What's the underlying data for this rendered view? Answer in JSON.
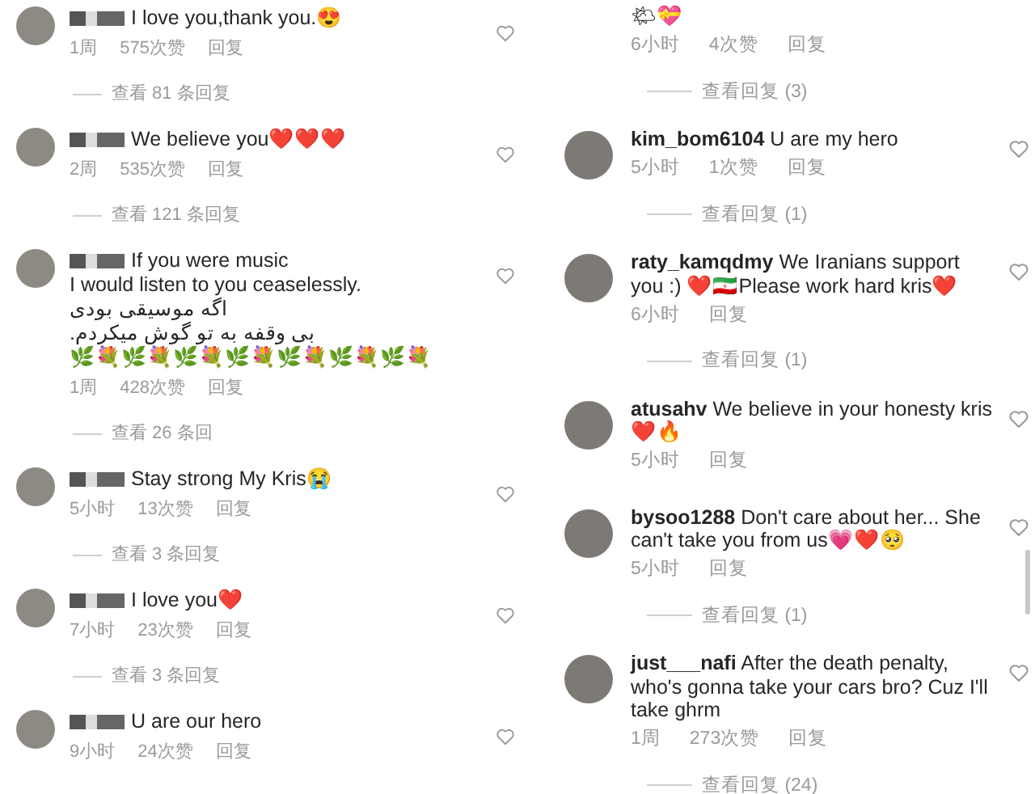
{
  "left_column": {
    "comments": [
      {
        "lines": [
          "I love you,thank you.😍"
        ],
        "time": "1周",
        "likes": "575次赞",
        "reply": "回复",
        "view_replies": "查看 81 条回复"
      },
      {
        "lines": [
          "We believe you❤️❤️❤️"
        ],
        "time": "2周",
        "likes": "535次赞",
        "reply": "回复",
        "view_replies": "查看 121 条回复"
      },
      {
        "lines": [
          "If you were music",
          "I would listen to you ceaselessly.",
          "اگه موسیقی بودی",
          "بی وقفه به تو گوش میکردم.",
          "🌿💐🌿💐🌿💐🌿💐🌿💐🌿💐🌿💐"
        ],
        "time": "1周",
        "likes": "428次赞",
        "reply": "回复",
        "view_replies": "查看 26 条回"
      },
      {
        "lines": [
          "Stay strong My Kris😭"
        ],
        "time": "5小时",
        "likes": "13次赞",
        "reply": "回复",
        "view_replies": "查看 3 条回复"
      },
      {
        "lines": [
          "I love you❤️"
        ],
        "time": "7小时",
        "likes": "23次赞",
        "reply": "回复",
        "view_replies": "查看 3 条回复"
      },
      {
        "lines": [
          "U are our hero"
        ],
        "time": "9小时",
        "likes": "24次赞",
        "reply": "回复"
      }
    ]
  },
  "right_column": {
    "comments": [
      {
        "lines": [
          "🌤💝"
        ],
        "time": "6小时",
        "likes": "4次赞",
        "reply": "回复",
        "view_replies": "查看回复 (3)"
      },
      {
        "username": "kim_bom6104",
        "lines": [
          "U are my hero"
        ],
        "time": "5小时",
        "likes": "1次赞",
        "reply": "回复",
        "view_replies": "查看回复 (1)"
      },
      {
        "username": "raty_kamqdmy",
        "lines": [
          "We Iranians support",
          "you :) ❤️🇮🇷Please work hard kris❤️"
        ],
        "time": "6小时",
        "reply": "回复",
        "view_replies": "查看回复 (1)"
      },
      {
        "username": "atusahv",
        "lines": [
          "We believe in your honesty kris",
          "❤️🔥"
        ],
        "time": "5小时",
        "reply": "回复"
      },
      {
        "username": "bysoo1288",
        "lines": [
          "Don't care about her... She",
          "can't take you from us💗❤️🥺"
        ],
        "time": "5小时",
        "reply": "回复",
        "view_replies": "查看回复 (1)"
      },
      {
        "username": "just___nafi",
        "lines": [
          "After the death penalty,",
          "who's gonna take your cars bro? Cuz I'll",
          "take ghrm"
        ],
        "time": "1周",
        "likes": "273次赞",
        "reply": "回复",
        "view_replies": "查看回复 (24)"
      }
    ]
  }
}
